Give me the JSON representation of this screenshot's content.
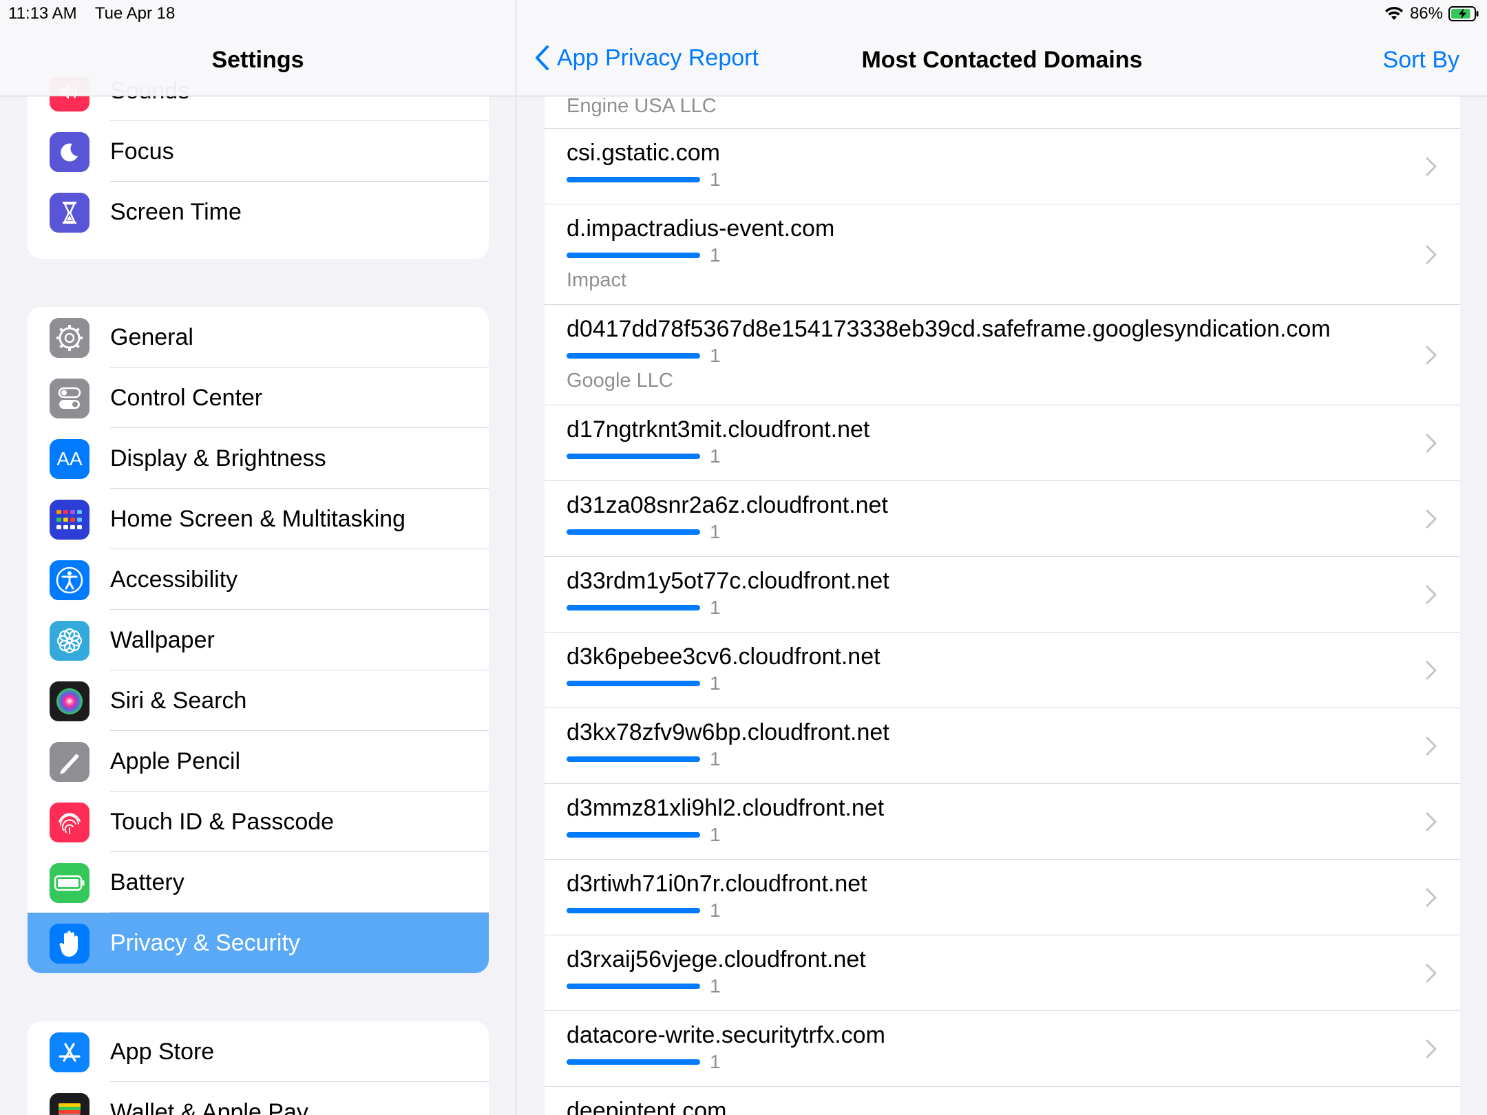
{
  "status": {
    "time": "11:13 AM",
    "date": "Tue Apr 18",
    "battery_percent": "86%",
    "battery_level": 0.86
  },
  "sidebar": {
    "title": "Settings",
    "groups": [
      {
        "items": [
          {
            "label": "Sounds",
            "icon": "speaker-icon",
            "color": "#ff2d55"
          },
          {
            "label": "Focus",
            "icon": "moon-icon",
            "color": "#5856d6"
          },
          {
            "label": "Screen Time",
            "icon": "hourglass-icon",
            "color": "#5856d6"
          }
        ]
      },
      {
        "items": [
          {
            "label": "General",
            "icon": "gear-icon",
            "color": "#8e8e93"
          },
          {
            "label": "Control Center",
            "icon": "toggles-icon",
            "color": "#8e8e93"
          },
          {
            "label": "Display & Brightness",
            "icon": "text-size-icon",
            "color": "#007aff"
          },
          {
            "label": "Home Screen & Multitasking",
            "icon": "app-grid-icon",
            "color": "#2c3ed6"
          },
          {
            "label": "Accessibility",
            "icon": "accessibility-icon",
            "color": "#007aff"
          },
          {
            "label": "Wallpaper",
            "icon": "flower-icon",
            "color": "#34aadc"
          },
          {
            "label": "Siri & Search",
            "icon": "siri-icon",
            "color": "#1c1c1e"
          },
          {
            "label": "Apple Pencil",
            "icon": "pencil-icon",
            "color": "#8e8e93"
          },
          {
            "label": "Touch ID & Passcode",
            "icon": "fingerprint-icon",
            "color": "#ff2d55"
          },
          {
            "label": "Battery",
            "icon": "battery-icon",
            "color": "#34c759"
          },
          {
            "label": "Privacy & Security",
            "icon": "hand-icon",
            "color": "#007aff",
            "selected": true
          }
        ]
      },
      {
        "items": [
          {
            "label": "App Store",
            "icon": "app-store-icon",
            "color": "#0a84ff"
          },
          {
            "label": "Wallet & Apple Pay",
            "icon": "wallet-icon",
            "color": "#1c1c1e"
          }
        ]
      }
    ]
  },
  "detail": {
    "back_label": "App Privacy Report",
    "title": "Most Contacted Domains",
    "sort_label": "Sort By",
    "top_partial_owner": "Engine USA LLC",
    "domains": [
      {
        "name": "csi.gstatic.com",
        "count": "1",
        "owner": ""
      },
      {
        "name": "d.impactradius-event.com",
        "count": "1",
        "owner": "Impact"
      },
      {
        "name": "d0417dd78f5367d8e154173338eb39cd.safeframe.googlesyndication.com",
        "count": "1",
        "owner": "Google LLC"
      },
      {
        "name": "d17ngtrknt3mit.cloudfront.net",
        "count": "1",
        "owner": ""
      },
      {
        "name": "d31za08snr2a6z.cloudfront.net",
        "count": "1",
        "owner": ""
      },
      {
        "name": "d33rdm1y5ot77c.cloudfront.net",
        "count": "1",
        "owner": ""
      },
      {
        "name": "d3k6pebee3cv6.cloudfront.net",
        "count": "1",
        "owner": ""
      },
      {
        "name": "d3kx78zfv9w6bp.cloudfront.net",
        "count": "1",
        "owner": ""
      },
      {
        "name": "d3mmz81xli9hl2.cloudfront.net",
        "count": "1",
        "owner": ""
      },
      {
        "name": "d3rtiwh71i0n7r.cloudfront.net",
        "count": "1",
        "owner": ""
      },
      {
        "name": "d3rxaij56vjege.cloudfront.net",
        "count": "1",
        "owner": ""
      },
      {
        "name": "datacore-write.securitytrfx.com",
        "count": "1",
        "owner": ""
      },
      {
        "name": "deepintent.com",
        "count": "",
        "owner": ""
      }
    ]
  },
  "colors": {
    "accent": "#007aff",
    "selected_row": "#5aa9f7"
  }
}
